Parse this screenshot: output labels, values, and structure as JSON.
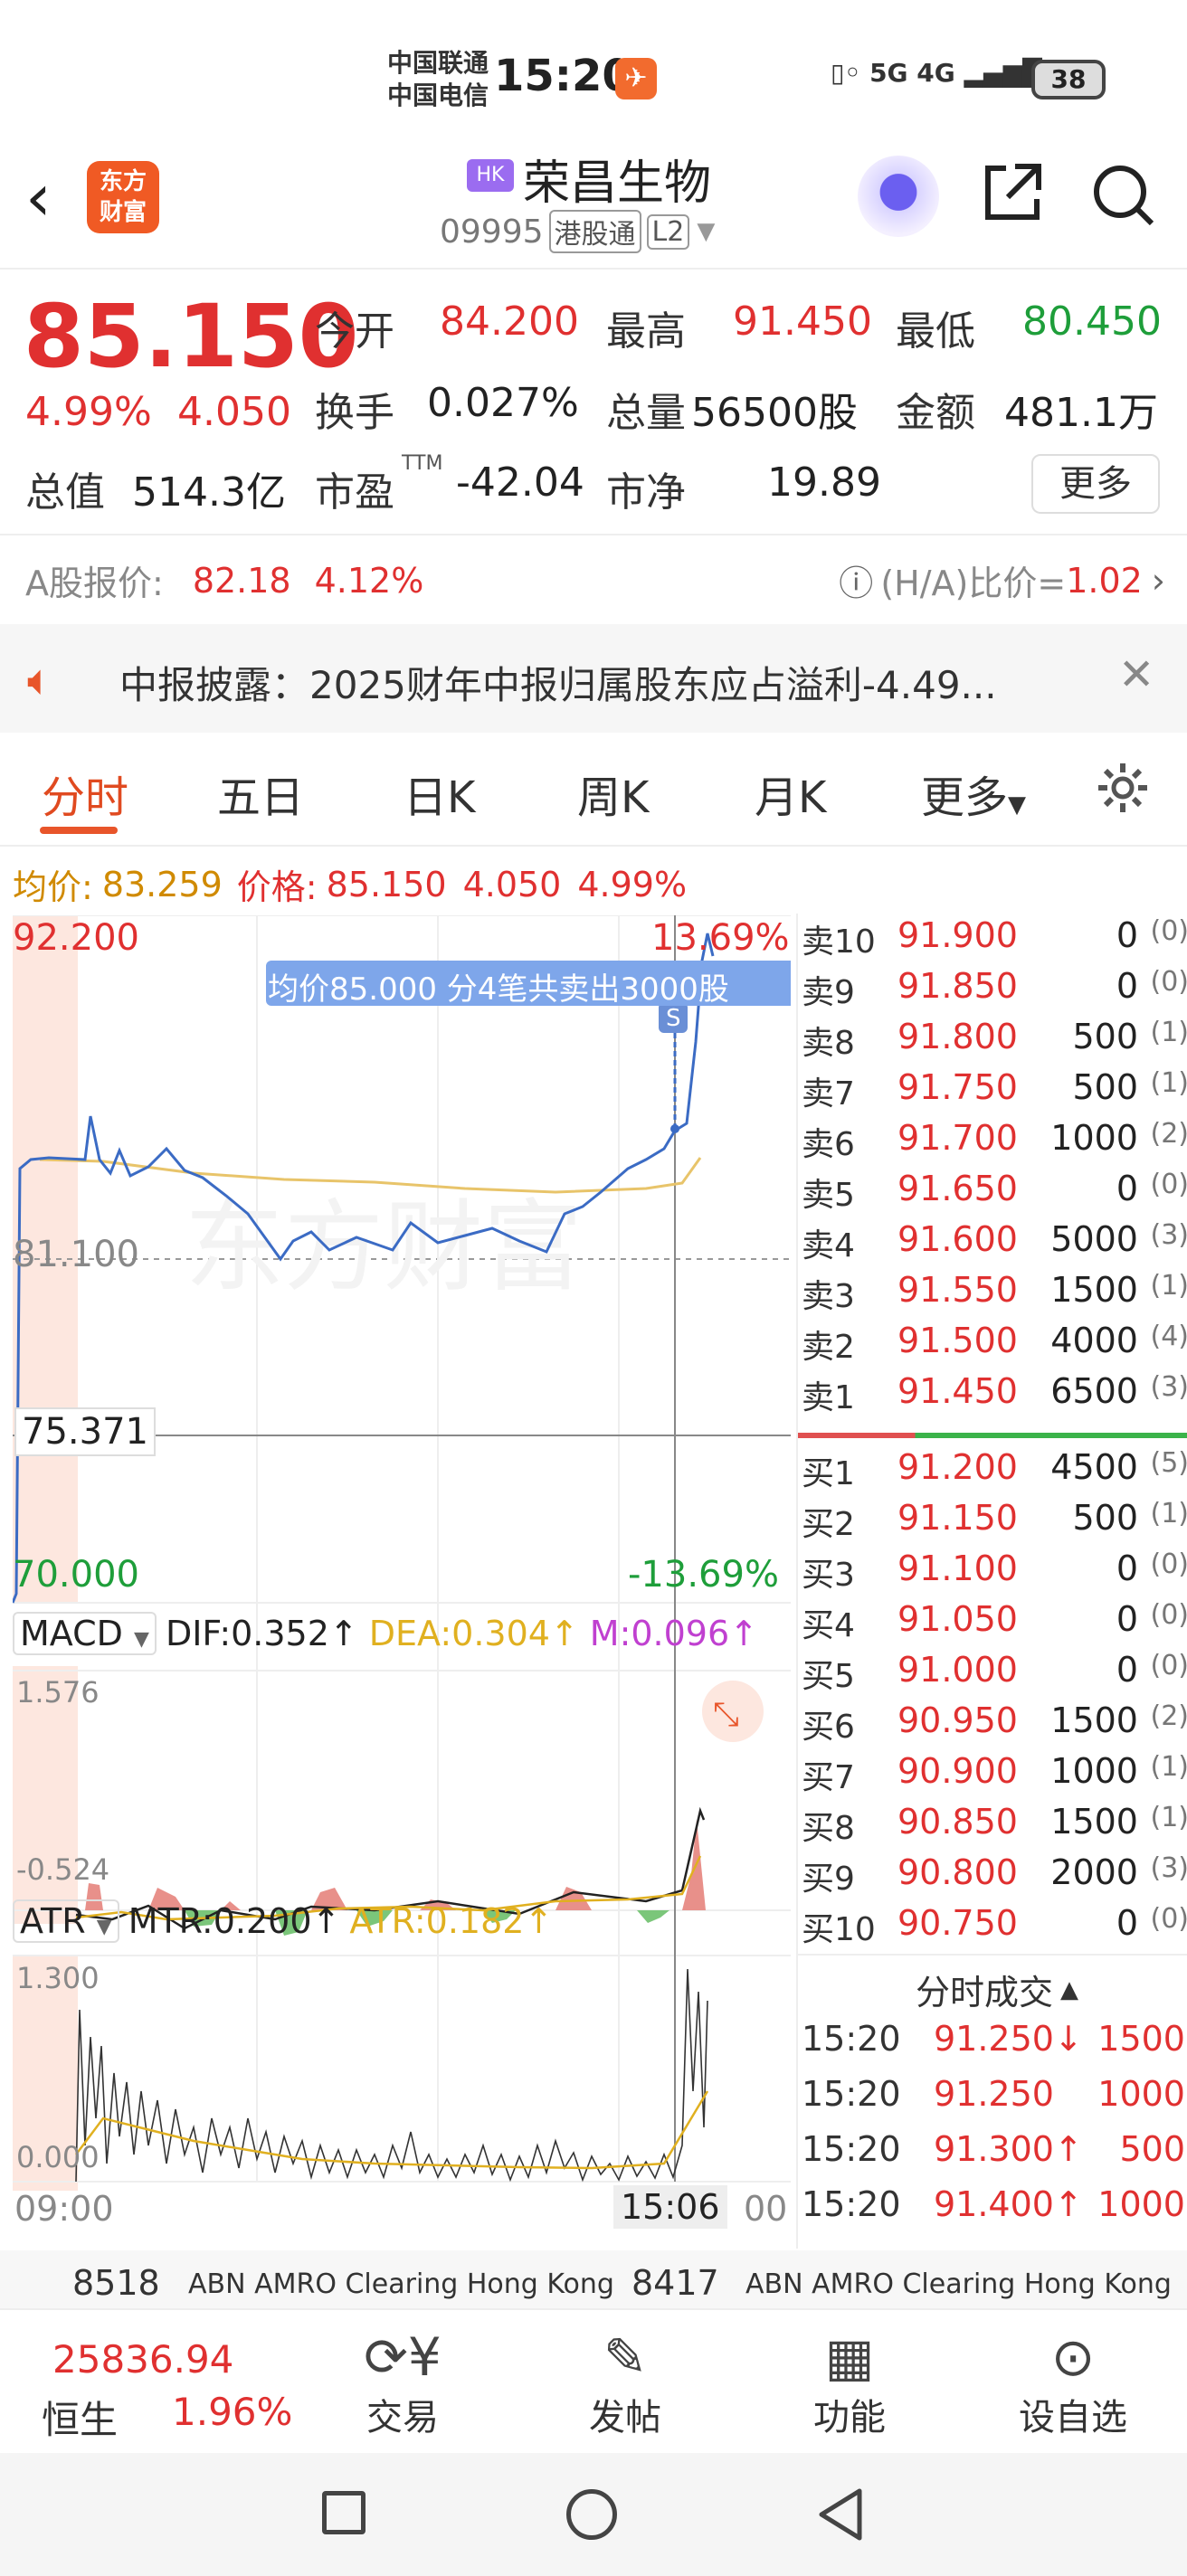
{
  "status": {
    "carrier1": "中国联通",
    "carrier2": "中国电信",
    "time": "15:20",
    "signal": "5G 4G",
    "battery": "38"
  },
  "header": {
    "market_tag": "HK",
    "stock_name": "荣昌生物",
    "code": "09995",
    "channel": "港股通",
    "level": "L2",
    "logo": "东方财富"
  },
  "quote": {
    "price": "85.150",
    "change_pct": "4.99%",
    "change": "4.050",
    "open_label": "今开",
    "open": "84.200",
    "high_label": "最高",
    "high": "91.450",
    "low_label": "最低",
    "low": "80.450",
    "turnover_label": "换手",
    "turnover": "0.027%",
    "volume_label": "总量",
    "volume": "56500股",
    "amount_label": "金额",
    "amount": "481.1万",
    "mcap_label": "总值",
    "mcap": "514.3亿",
    "pe_label": "市盈",
    "pe_sup": "TTM",
    "pe": "-42.04",
    "pb_label": "市净",
    "pb": "19.89",
    "more": "更多"
  },
  "ashare": {
    "label": "A股报价:",
    "price": "82.18",
    "pct": "4.12%",
    "ratio_label": "(H/A)比价=",
    "ratio": "1.02"
  },
  "notice": {
    "text": "中报披露：2025财年中报归属股东应占溢利-4.49..."
  },
  "tabs": [
    "分时",
    "五日",
    "日K",
    "周K",
    "月K",
    "更多"
  ],
  "avgbar": {
    "avg_label": "均价:",
    "avg": "83.259",
    "price_label": "价格:",
    "price": "85.150",
    "change": "4.050",
    "pct": "4.99%"
  },
  "chart": {
    "y_top": "92.200",
    "pct_top": "13.69%",
    "y_mid": "81.100",
    "y_cross": "75.371",
    "y_bottom": "70.000",
    "pct_bottom": "-13.69%",
    "tooltip": "均价85.000  分4笔共卖出3000股",
    "watermark": "东方财富",
    "macd_name": "MACD",
    "dif": "DIF:0.352↑",
    "dea": "DEA:0.304↑",
    "m": "M:0.096↑",
    "macd_top": "1.576",
    "macd_bottom": "-0.524",
    "atr_name": "ATR",
    "mtr": "MTR:0.200↑",
    "atr": "ATR:0.182↑",
    "atr_top": "1.300",
    "atr_bottom": "0.000",
    "time_start": "09:00",
    "time_cross": "15:06",
    "time_end": "00"
  },
  "orderbook": {
    "asks": [
      {
        "label": "卖10",
        "price": "91.900",
        "vol": "0",
        "n": "(0)"
      },
      {
        "label": "卖9",
        "price": "91.850",
        "vol": "0",
        "n": "(0)"
      },
      {
        "label": "卖8",
        "price": "91.800",
        "vol": "500",
        "n": "(1)"
      },
      {
        "label": "卖7",
        "price": "91.750",
        "vol": "500",
        "n": "(1)"
      },
      {
        "label": "卖6",
        "price": "91.700",
        "vol": "1000",
        "n": "(2)"
      },
      {
        "label": "卖5",
        "price": "91.650",
        "vol": "0",
        "n": "(0)"
      },
      {
        "label": "卖4",
        "price": "91.600",
        "vol": "5000",
        "n": "(3)"
      },
      {
        "label": "卖3",
        "price": "91.550",
        "vol": "1500",
        "n": "(1)"
      },
      {
        "label": "卖2",
        "price": "91.500",
        "vol": "4000",
        "n": "(4)"
      },
      {
        "label": "卖1",
        "price": "91.450",
        "vol": "6500",
        "n": "(3)"
      }
    ],
    "bids": [
      {
        "label": "买1",
        "price": "91.200",
        "vol": "4500",
        "n": "(5)"
      },
      {
        "label": "买2",
        "price": "91.150",
        "vol": "500",
        "n": "(1)"
      },
      {
        "label": "买3",
        "price": "91.100",
        "vol": "0",
        "n": "(0)"
      },
      {
        "label": "买4",
        "price": "91.050",
        "vol": "0",
        "n": "(0)"
      },
      {
        "label": "买5",
        "price": "91.000",
        "vol": "0",
        "n": "(0)"
      },
      {
        "label": "买6",
        "price": "90.950",
        "vol": "1500",
        "n": "(2)"
      },
      {
        "label": "买7",
        "price": "90.900",
        "vol": "1000",
        "n": "(1)"
      },
      {
        "label": "买8",
        "price": "90.850",
        "vol": "1500",
        "n": "(1)"
      },
      {
        "label": "买9",
        "price": "90.800",
        "vol": "2000",
        "n": "(3)"
      },
      {
        "label": "买10",
        "price": "90.750",
        "vol": "0",
        "n": "(0)"
      }
    ],
    "ticks_title": "分时成交",
    "ticks": [
      {
        "time": "15:20",
        "price": "91.250↓",
        "vol": "1500"
      },
      {
        "time": "15:20",
        "price": "91.250",
        "vol": "1000"
      },
      {
        "time": "15:20",
        "price": "91.300↑",
        "vol": "500"
      },
      {
        "time": "15:20",
        "price": "91.400↑",
        "vol": "1000"
      }
    ]
  },
  "brokers": {
    "left_code": "8518",
    "left_name": "ABN AMRO Clearing Hong Kong",
    "right_code": "8417",
    "right_name": "ABN AMRO Clearing Hong Kong"
  },
  "bottomnav": {
    "index_value": "25836.94",
    "index_name": "恒生",
    "index_pct": "1.96%",
    "trade": "交易",
    "post": "发帖",
    "function": "功能",
    "watch": "设自选"
  }
}
